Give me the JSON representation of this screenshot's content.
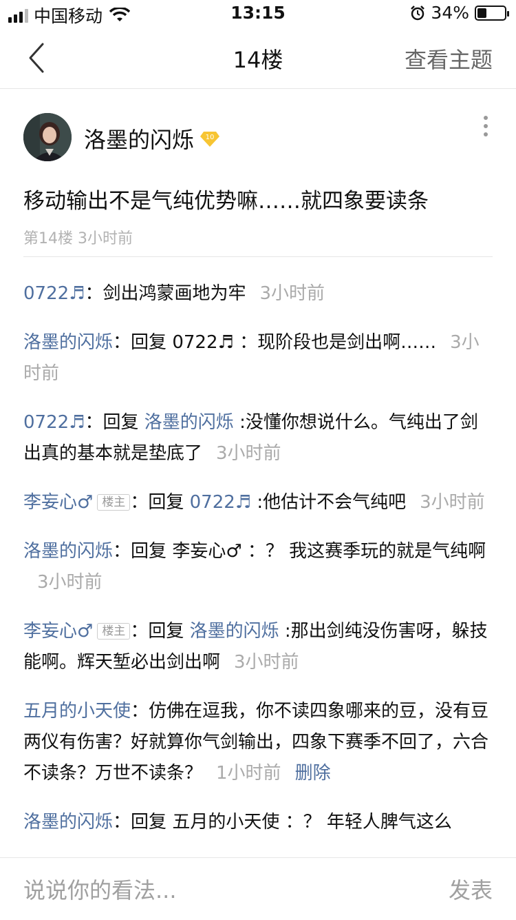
{
  "status": {
    "carrier": "中国移动",
    "time": "13:15",
    "battery": "34%",
    "battery_level": 0.34
  },
  "nav": {
    "title": "14楼",
    "action": "查看主题"
  },
  "post": {
    "author": "洛墨的闪烁",
    "level": "10",
    "text": "移动输出不是气纯优势嘛……就四象要读条",
    "meta": "第14楼 3小时前"
  },
  "replies": [
    {
      "name": "0722♬",
      "sep": "：",
      "text": "剑出鸿蒙画地为牢",
      "time": "3小时前"
    },
    {
      "name": "洛墨的闪烁",
      "sep": "：",
      "reply_label": "回复",
      "target_plain": "0722♬",
      "text": "：现阶段也是剑出啊……",
      "time": "3小时前"
    },
    {
      "name": "0722♬",
      "sep": "：",
      "reply_label": "回复",
      "target_link": "洛墨的闪烁",
      "text": ":没懂你想说什么。气纯出了剑出真的基本就是垫底了",
      "time": "3小时前"
    },
    {
      "name": "李妄心♂",
      "badge": "楼主",
      "sep": "：",
      "reply_label": "回复",
      "target_link": "0722♬",
      "text": ":他估计不会气纯吧",
      "time": "3小时前"
    },
    {
      "name": "洛墨的闪烁",
      "sep": "：",
      "reply_label": "回复",
      "target_plain": "李妄心♂",
      "text": "：？ 我这赛季玩的就是气纯啊",
      "time": "3小时前"
    },
    {
      "name": "李妄心♂",
      "badge": "楼主",
      "sep": "：",
      "reply_label": "回复",
      "target_link": "洛墨的闪烁",
      "text": ":那出剑纯没伤害呀，躲技能啊。辉天堑必出剑出啊",
      "time": "3小时前"
    },
    {
      "name": "五月的小天使",
      "sep": "：",
      "text": "仿佛在逗我，你不读四象哪来的豆，没有豆两仪有伤害？好就算你气剑输出，四象下赛季不回了，六合不读条？万世不读条？",
      "time": "1小时前",
      "delete_label": "删除"
    },
    {
      "name": "洛墨的闪烁",
      "sep": "：",
      "reply_label": "回复",
      "target_plain": "五月的小天使",
      "text": "：？ 年轻人脾气这么"
    }
  ],
  "bottom": {
    "placeholder": "说说你的看法...",
    "publish": "发表"
  }
}
